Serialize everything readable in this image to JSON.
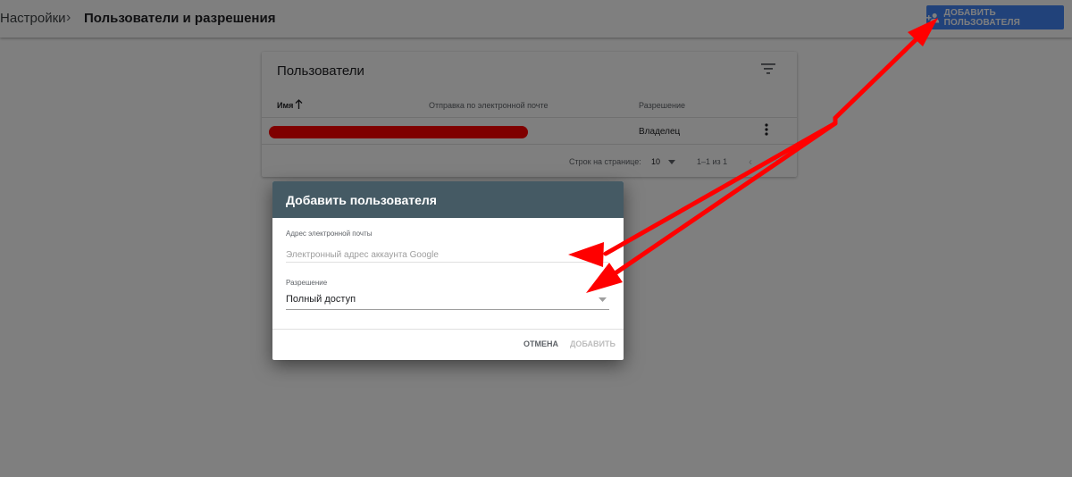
{
  "header": {
    "breadcrumb_root": "Настройки",
    "breadcrumb_separator": "›",
    "breadcrumb_current": "Пользователи и разрешения",
    "add_user_button": "ДОБАВИТЬ ПОЛЬЗОВАТЕЛЯ",
    "add_user_icon": "person-add-icon"
  },
  "users_card": {
    "title": "Пользователи",
    "filter_icon": "filter-icon",
    "columns": {
      "name": "Имя",
      "email": "Отправка по электронной почте",
      "permission": "Разрешение"
    },
    "sort_icon": "arrow-up-icon",
    "rows": [
      {
        "name": "",
        "email": "",
        "permission": "Владелец"
      }
    ],
    "footer": {
      "rows_per_page_label": "Строк на странице:",
      "rows_per_page_value": "10",
      "range": "1–1 из 1",
      "prev": "‹",
      "next": "›"
    }
  },
  "dialog": {
    "title": "Добавить пользователя",
    "email_label": "Адрес электронной почты",
    "email_placeholder": "Электронный адрес аккаунта Google",
    "email_value": "",
    "permission_label": "Разрешение",
    "permission_value": "Полный доступ",
    "cancel_button": "ОТМЕНА",
    "add_button": "ДОБАВИТЬ"
  },
  "colors": {
    "primary": "#4285f4",
    "dialog_header": "#455a64",
    "annotation": "#ff0000"
  }
}
